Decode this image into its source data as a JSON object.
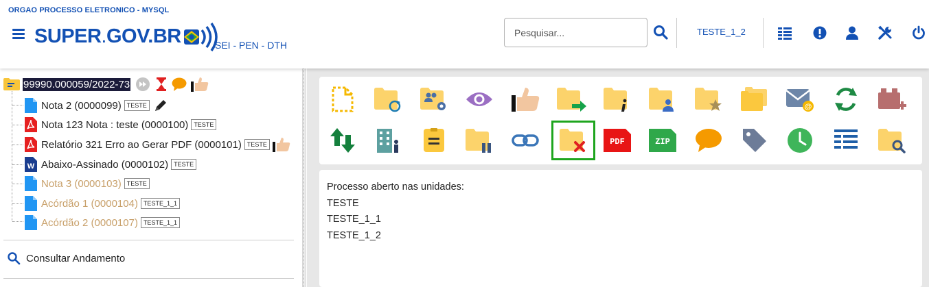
{
  "header": {
    "org_name": "ORGAO PROCESSO ELETRONICO - MYSQL",
    "logo_text_left": "SUPER",
    "logo_text_dot": ".",
    "logo_text_right": "GOV.BR",
    "subsystem": "SEI - PEN - DTH",
    "search_placeholder": "Pesquisar...",
    "unit_selector": "TESTE_1_2",
    "icons": [
      "search-icon",
      "tasks-icon",
      "alert-icon",
      "user-icon",
      "tools-icon",
      "power-icon"
    ],
    "brand_color": "#1351b4"
  },
  "tree": {
    "process_number": "99990.000059/2022-73",
    "documents": [
      {
        "label": "Nota 2 (0000099)",
        "unit": "TESTE",
        "icon": "document-icon",
        "muted": false,
        "extra": "signature-pen-icon"
      },
      {
        "label": "Nota 123 Nota : teste (0000100)",
        "unit": "TESTE",
        "icon": "pdf-icon",
        "muted": false
      },
      {
        "label": "Relatório 321 Erro ao Gerar PDF (0000101)",
        "unit": "TESTE",
        "icon": "pdf-icon",
        "muted": false,
        "extra": "thumb-icon"
      },
      {
        "label": "Abaixo-Assinado (0000102)",
        "unit": "TESTE",
        "icon": "word-icon",
        "muted": false
      },
      {
        "label": "Nota 3 (0000103)",
        "unit": "TESTE",
        "icon": "document-icon",
        "muted": true
      },
      {
        "label": "Acórdão 1 (0000104)",
        "unit": "TESTE_1_1",
        "icon": "document-icon",
        "muted": true
      },
      {
        "label": "Acórdão 2 (0000107)",
        "unit": "TESTE_1_1",
        "icon": "document-icon",
        "muted": true
      }
    ],
    "consultar_label": "Consultar Andamento"
  },
  "toolbar": {
    "row1": [
      "new-document-icon",
      "update-process-icon",
      "assign-process-icon",
      "view-icon",
      "thumb-icon",
      "send-process-icon",
      "process-info-icon",
      "assign-user-icon",
      "favorite-icon",
      "folders-icon",
      "email-icon",
      "sync-icon",
      "add-block-icon"
    ],
    "row2": [
      "relate-icon",
      "unit-access-icon",
      "notes-icon",
      "suspend-icon",
      "link-icon",
      "close-process-icon",
      "pdf-export-icon",
      "zip-export-icon",
      "comment-icon",
      "tag-icon",
      "deadline-icon",
      "list-icon",
      "search-process-icon"
    ],
    "selected": "close-process-icon",
    "pdf_label": "PDF",
    "zip_label": "ZIP",
    "selected_color": "#1ea51e"
  },
  "info": {
    "heading": "Processo aberto nas unidades:",
    "units": [
      "TESTE",
      "TESTE_1_1",
      "TESTE_1_2"
    ]
  }
}
